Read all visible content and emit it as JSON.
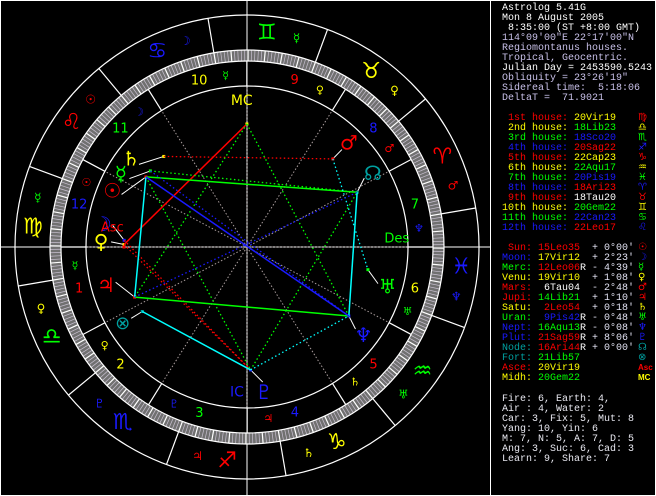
{
  "info": [
    {
      "text": "Astrolog 5.41G",
      "color": "#ffffff"
    },
    {
      "text": "Mon 8 August 2005",
      "color": "#ffffff"
    },
    {
      "text": " 8:35:00 (ST +8:00 GMT)",
      "color": "#ffffff"
    },
    {
      "text": "114°09'00\"E 22°17'00\"N",
      "color": "#c8c0e8"
    },
    {
      "text": "Regiomontanus houses.",
      "color": "#c8c0e8"
    },
    {
      "text": "Tropical, Geocentric.",
      "color": "#c8c0e8"
    },
    {
      "text": "Julian Day = 2453590.5243",
      "color": "#ffffff"
    },
    {
      "text": "Obliquity = 23°26'19\"",
      "color": "#c8c0e8"
    },
    {
      "text": "Sidereal time:  5:18:06",
      "color": "#c8c0e8"
    },
    {
      "text": "DeltaT =  71.9021",
      "color": "#c8c0e8"
    }
  ],
  "colors": {
    "red": "#ff0000",
    "yellow": "#ffff00",
    "green": "#00ff00",
    "blue": "#1a1aff",
    "cyan": "#00ffff",
    "teal": "#00a0a0",
    "white": "#ffffff",
    "gray": "#b0a8a8",
    "lat": "#e0e0f0"
  },
  "signs": [
    {
      "abbr": "Ari",
      "glyph": "♈",
      "color": "#ff0000",
      "ruler": "♂",
      "ruler_color": "#ff0000"
    },
    {
      "abbr": "Tau",
      "glyph": "♉",
      "color": "#ffff00",
      "ruler": "♀",
      "ruler_color": "#ffff00"
    },
    {
      "abbr": "Gem",
      "glyph": "♊",
      "color": "#00ff00",
      "ruler": "☿",
      "ruler_color": "#00ff00"
    },
    {
      "abbr": "Can",
      "glyph": "♋",
      "color": "#1a1aff",
      "ruler": "☽",
      "ruler_color": "#1a1aff"
    },
    {
      "abbr": "Leo",
      "glyph": "♌",
      "color": "#ff0000",
      "ruler": "☉",
      "ruler_color": "#ff0000"
    },
    {
      "abbr": "Vir",
      "glyph": "♍",
      "color": "#ffff00",
      "ruler": "☿",
      "ruler_color": "#00ff00"
    },
    {
      "abbr": "Lib",
      "glyph": "♎",
      "color": "#00ff00",
      "ruler": "♀",
      "ruler_color": "#ffff00"
    },
    {
      "abbr": "Sco",
      "glyph": "♏",
      "color": "#1a1aff",
      "ruler": "♇",
      "ruler_color": "#1a1aff"
    },
    {
      "abbr": "Sag",
      "glyph": "♐",
      "color": "#ff0000",
      "ruler": "♃",
      "ruler_color": "#ff0000"
    },
    {
      "abbr": "Cap",
      "glyph": "♑",
      "color": "#ffff00",
      "ruler": "♄",
      "ruler_color": "#ffff00"
    },
    {
      "abbr": "Aqu",
      "glyph": "♒",
      "color": "#00ff00",
      "ruler": "♅",
      "ruler_color": "#00ff00"
    },
    {
      "abbr": "Pis",
      "glyph": "♓",
      "color": "#1a1aff",
      "ruler": "♆",
      "ruler_color": "#1a1aff"
    }
  ],
  "houses": [
    {
      "num": "1",
      "label": "1st house:",
      "value": "20Vir19",
      "label_color": "#ff0000",
      "value_color": "#ffff00",
      "glyph": "♍"
    },
    {
      "num": "2",
      "label": "2nd house:",
      "value": "18Lib23",
      "label_color": "#ffff00",
      "value_color": "#00ff00",
      "glyph": "♎"
    },
    {
      "num": "3",
      "label": "3rd house:",
      "value": "18Sco20",
      "label_color": "#00ff00",
      "value_color": "#1a1aff",
      "glyph": "♏"
    },
    {
      "num": "4",
      "label": "4th house:",
      "value": "20Sag22",
      "label_color": "#1a1aff",
      "value_color": "#ff0000",
      "glyph": "♐"
    },
    {
      "num": "5",
      "label": "5th house:",
      "value": "22Cap23",
      "label_color": "#ff0000",
      "value_color": "#ffff00",
      "glyph": "♑"
    },
    {
      "num": "6",
      "label": "6th house:",
      "value": "22Aqu17",
      "label_color": "#ffff00",
      "value_color": "#00ff00",
      "glyph": "♒"
    },
    {
      "num": "7",
      "label": "7th house:",
      "value": "20Pis19",
      "label_color": "#00ff00",
      "value_color": "#1a1aff",
      "glyph": "♓"
    },
    {
      "num": "8",
      "label": "8th house:",
      "value": "18Ari23",
      "label_color": "#1a1aff",
      "value_color": "#ff0000",
      "glyph": "♈"
    },
    {
      "num": "9",
      "label": "9th house:",
      "value": "18Tau20",
      "label_color": "#ff0000",
      "value_color": "#ffffff",
      "glyph": "♉"
    },
    {
      "num": "10",
      "label": "10th house:",
      "value": "20Gem22",
      "label_color": "#ffff00",
      "value_color": "#00ff00",
      "glyph": "♊"
    },
    {
      "num": "11",
      "label": "11th house:",
      "value": "22Can23",
      "label_color": "#00ff00",
      "value_color": "#1a1aff",
      "glyph": "♋"
    },
    {
      "num": "12",
      "label": "12th house:",
      "value": "22Leo17",
      "label_color": "#1a1aff",
      "value_color": "#ff0000",
      "glyph": "♌"
    }
  ],
  "planets": [
    {
      "key": "sun",
      "label": "Sun:",
      "value": "15Leo35",
      "retro": "",
      "lat": "+ 0°00'",
      "glyph": "☉",
      "color": "#ff0000",
      "value_color": "#ff0000"
    },
    {
      "key": "moon",
      "label": "Moon:",
      "value": "17Vir12",
      "retro": "",
      "lat": "+ 2°23'",
      "glyph": "☽",
      "color": "#1a1aff",
      "value_color": "#ffff00"
    },
    {
      "key": "mercury",
      "label": "Merc:",
      "value": "12Leo06",
      "retro": "R",
      "lat": "- 4°39'",
      "glyph": "☿",
      "color": "#00ff00",
      "value_color": "#ff0000"
    },
    {
      "key": "venus",
      "label": "Venu:",
      "value": "19Vir10",
      "retro": "",
      "lat": "+ 1°08'",
      "glyph": "♀",
      "color": "#ffff00",
      "value_color": "#ffff00"
    },
    {
      "key": "mars",
      "label": "Mars:",
      "value": " 6Tau04",
      "retro": "",
      "lat": "- 2°48'",
      "glyph": "♂",
      "color": "#ff0000",
      "value_color": "#ffffff"
    },
    {
      "key": "jupiter",
      "label": "Jupi:",
      "value": "14Lib21",
      "retro": "",
      "lat": "+ 1°10'",
      "glyph": "♃",
      "color": "#ff0000",
      "value_color": "#00ff00"
    },
    {
      "key": "saturn",
      "label": "Satu:",
      "value": " 2Leo54",
      "retro": "",
      "lat": "+ 0°18'",
      "glyph": "♄",
      "color": "#ffff00",
      "value_color": "#ff0000"
    },
    {
      "key": "uranus",
      "label": "Uran:",
      "value": " 9Pis42",
      "retro": "R",
      "lat": "- 0°48'",
      "glyph": "♅",
      "color": "#00ff00",
      "value_color": "#1a1aff"
    },
    {
      "key": "neptune",
      "label": "Nept:",
      "value": "16Aqu13",
      "retro": "R",
      "lat": "- 0°08'",
      "glyph": "♆",
      "color": "#1a1aff",
      "value_color": "#00ff00"
    },
    {
      "key": "pluto",
      "label": "Plut:",
      "value": "21Sag59",
      "retro": "R",
      "lat": "+ 8°06'",
      "glyph": "♇",
      "color": "#1a1aff",
      "value_color": "#ff0000"
    },
    {
      "key": "node",
      "label": "Node:",
      "value": "16Ari44",
      "retro": "R",
      "lat": "+ 0°00'",
      "glyph": "☊",
      "color": "#00a0a0",
      "value_color": "#ff0000"
    },
    {
      "key": "fortune",
      "label": "Fort:",
      "value": "21Lib57",
      "retro": "",
      "lat": "",
      "glyph": "⊗",
      "color": "#00a0a0",
      "value_color": "#00ff00"
    },
    {
      "key": "asc",
      "label": "Asce:",
      "value": "20Vir19",
      "retro": "",
      "lat": "",
      "glyph": "Asc",
      "color": "#ff0000",
      "value_color": "#ffff00"
    },
    {
      "key": "mc",
      "label": "Midh:",
      "value": "20Gem22",
      "retro": "",
      "lat": "",
      "glyph": "MC",
      "color": "#ffff00",
      "value_color": "#00ff00"
    }
  ],
  "angles": {
    "asc": "Asc",
    "mc": "MC",
    "des": "Des",
    "ic": "IC"
  },
  "aspects": [
    {
      "a": "saturn",
      "b": "mars",
      "type": "square",
      "angle": 90
    },
    {
      "a": "venus",
      "b": "mc",
      "type": "square",
      "angle": 90
    },
    {
      "a": "venus",
      "b": "pluto",
      "type": "square",
      "angle": 90
    },
    {
      "a": "moon",
      "b": "pluto",
      "type": "square",
      "angle": 90
    },
    {
      "a": "sun",
      "b": "node",
      "type": "trine",
      "angle": 120
    },
    {
      "a": "mercury",
      "b": "node",
      "type": "trine",
      "angle": 120
    },
    {
      "a": "mc",
      "b": "jupiter",
      "type": "trine",
      "angle": 120
    },
    {
      "a": "mc",
      "b": "neptune",
      "type": "trine",
      "angle": 120
    },
    {
      "a": "jupiter",
      "b": "neptune",
      "type": "trine",
      "angle": 120
    },
    {
      "a": "sun",
      "b": "pluto",
      "type": "trine",
      "angle": 120
    },
    {
      "a": "pluto",
      "b": "node",
      "type": "trine",
      "angle": 120
    },
    {
      "a": "sun",
      "b": "jupiter",
      "type": "sextile",
      "angle": 60
    },
    {
      "a": "fortune",
      "b": "pluto",
      "type": "sextile",
      "angle": 60
    },
    {
      "a": "mars",
      "b": "uranus",
      "type": "sextile",
      "angle": 60
    },
    {
      "a": "node",
      "b": "neptune",
      "type": "sextile",
      "angle": 60
    },
    {
      "a": "pluto",
      "b": "neptune",
      "type": "sextile",
      "angle": 60
    },
    {
      "a": "sun",
      "b": "neptune",
      "type": "opposition",
      "angle": 180
    },
    {
      "a": "mercury",
      "b": "neptune",
      "type": "opposition",
      "angle": 180
    },
    {
      "a": "jupiter",
      "b": "node",
      "type": "opposition",
      "angle": 180
    }
  ],
  "aspect_colors": {
    "square": "#ff0000",
    "trine": "#00ff00",
    "sextile": "#00ffff",
    "opposition": "#1a1aff"
  },
  "elements": [
    "Fire: 6, Earth: 4,",
    "Air : 4, Water: 2",
    "Car: 3, Fix: 5, Mut: 8",
    "Yang: 10, Yin: 6",
    "M: 7, N: 5, A: 7, D: 5",
    "Ang: 3, Suc: 6, Cad: 3",
    "Learn: 9, Share: 7"
  ]
}
